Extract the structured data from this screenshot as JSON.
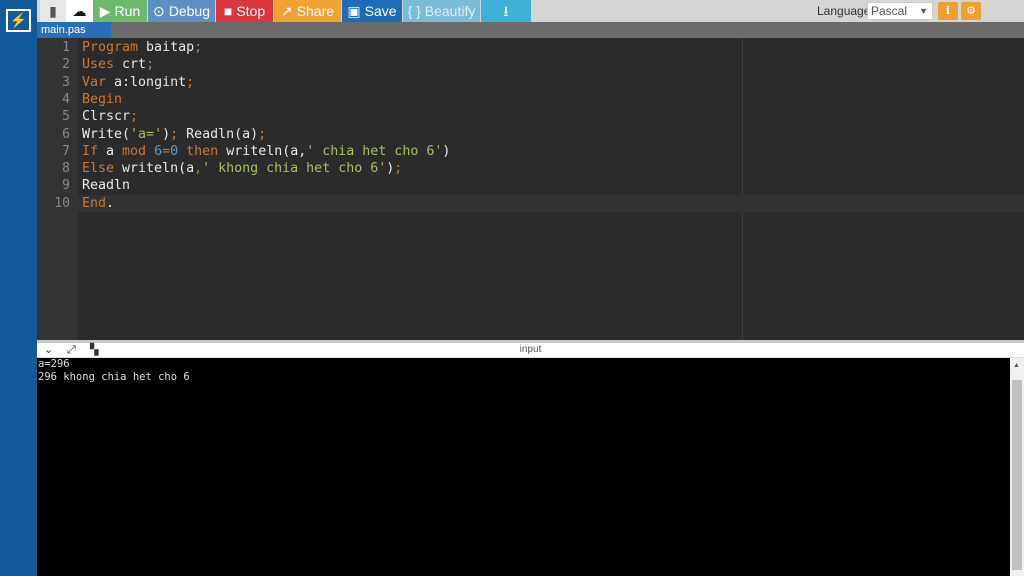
{
  "toolbar": {
    "new_file_icon": "file-icon",
    "upload_icon": "cloud-upload-icon",
    "run": "Run",
    "debug": "Debug",
    "stop": "Stop",
    "share": "Share",
    "save": "Save",
    "beautify": "{ } Beautify",
    "language_label": "Language",
    "language_value": "Pascal"
  },
  "tab": "main.pas",
  "code": [
    [
      [
        "Program",
        "kw"
      ],
      [
        " baitap",
        "id"
      ],
      [
        ";",
        "kw"
      ]
    ],
    [
      [
        "Uses",
        "kw"
      ],
      [
        " crt",
        "id"
      ],
      [
        ";",
        "kw"
      ]
    ],
    [
      [
        "Var",
        "kw"
      ],
      [
        " a:longint",
        "id"
      ],
      [
        ";",
        "kw"
      ]
    ],
    [
      [
        "Begin",
        "kw"
      ]
    ],
    [
      [
        "Clrscr",
        "id"
      ],
      [
        ";",
        "kw"
      ]
    ],
    [
      [
        "Write(",
        "id"
      ],
      [
        "'a='",
        "st"
      ],
      [
        ")",
        "id"
      ],
      [
        ";",
        "kw"
      ],
      [
        " Readln(a)",
        "id"
      ],
      [
        ";",
        "kw"
      ]
    ],
    [
      [
        "If",
        "kw"
      ],
      [
        " a ",
        "id"
      ],
      [
        "mod",
        "kw"
      ],
      [
        " ",
        "id"
      ],
      [
        "6",
        "nu"
      ],
      [
        "=",
        "kw"
      ],
      [
        "0",
        "nu"
      ],
      [
        " ",
        "id"
      ],
      [
        "then",
        "kw"
      ],
      [
        " writeln(a,",
        "id"
      ],
      [
        "' chia het cho 6'",
        "st"
      ],
      [
        ")",
        "id"
      ]
    ],
    [
      [
        "Else",
        "kw"
      ],
      [
        " writeln(a",
        "id"
      ],
      [
        ",",
        "kw"
      ],
      [
        "' khong chia het cho 6'",
        "st"
      ],
      [
        ")",
        "id"
      ],
      [
        ";",
        "kw"
      ]
    ],
    [
      [
        "Readln",
        "id"
      ]
    ],
    [
      [
        "End",
        "kw"
      ],
      [
        ".",
        "id"
      ]
    ]
  ],
  "panel": {
    "title": "input"
  },
  "console": [
    "a=296",
    "296 khong chia het cho 6"
  ],
  "colors": {
    "keyword": "#cc7832",
    "string": "#a5c25c",
    "number": "#6897bb",
    "sidebar": "#135a9a"
  }
}
